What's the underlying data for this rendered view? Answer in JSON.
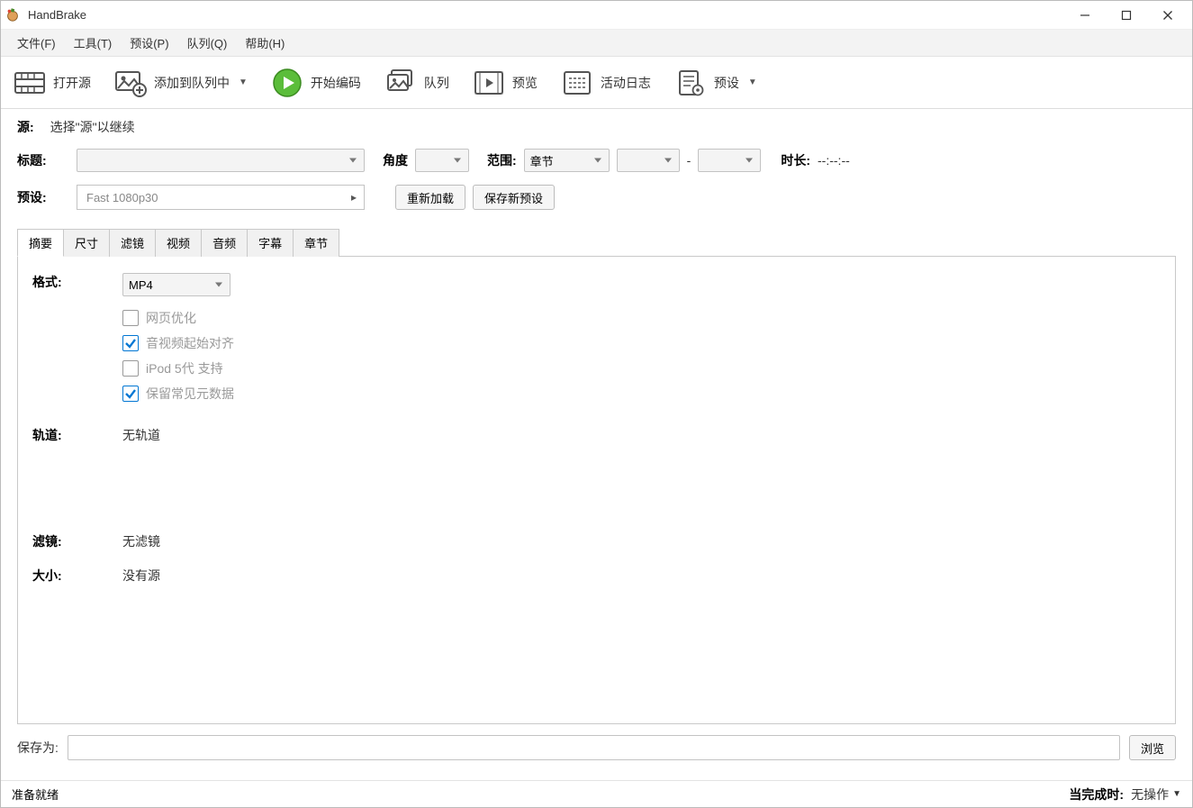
{
  "title": "HandBrake",
  "menu": [
    "文件(F)",
    "工具(T)",
    "预设(P)",
    "队列(Q)",
    "帮助(H)"
  ],
  "toolbar": {
    "open_source": "打开源",
    "add_to_queue": "添加到队列中",
    "start_encode": "开始编码",
    "queue": "队列",
    "preview": "预览",
    "activity_log": "活动日志",
    "presets": "预设"
  },
  "source": {
    "label": "源:",
    "hint": "选择\"源\"以继续"
  },
  "title_row": {
    "title_label": "标题:",
    "angle_label": "角度",
    "range_label": "范围:",
    "range_value": "章节",
    "dash": "-",
    "duration_label": "时长:",
    "duration_value": "--:--:--"
  },
  "preset_row": {
    "label": "预设:",
    "value": "Fast 1080p30",
    "reload": "重新加载",
    "save_new": "保存新预设"
  },
  "tabs": [
    "摘要",
    "尺寸",
    "滤镜",
    "视频",
    "音频",
    "字幕",
    "章节"
  ],
  "active_tab": 0,
  "summary": {
    "format_label": "格式:",
    "format_value": "MP4",
    "checkboxes": [
      {
        "label": "网页优化",
        "checked": false
      },
      {
        "label": "音视频起始对齐",
        "checked": true
      },
      {
        "label": "iPod 5代 支持",
        "checked": false
      },
      {
        "label": "保留常见元数据",
        "checked": true
      }
    ],
    "tracks_label": "轨道:",
    "tracks_value": "无轨道",
    "filters_label": "滤镜:",
    "filters_value": "无滤镜",
    "size_label": "大小:",
    "size_value": "没有源"
  },
  "save_as": {
    "label": "保存为:",
    "browse": "浏览"
  },
  "status": {
    "ready": "准备就绪",
    "when_done_label": "当完成时:",
    "when_done_value": "无操作"
  }
}
